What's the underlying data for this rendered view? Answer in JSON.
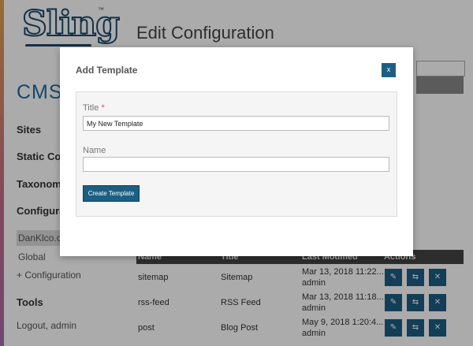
{
  "brand": {
    "logo_text": "Sling",
    "trademark": "™"
  },
  "header": {
    "title": "Edit Configuration"
  },
  "sidebar": {
    "cms_heading": "CMS",
    "sections": [
      "Sites",
      "Static Con",
      "Taxonom",
      "Configura"
    ],
    "config_items": [
      "DanKlco.co",
      "Global"
    ],
    "add_link": "+ Configuration",
    "tools_heading": "Tools",
    "logout": "Logout, admin"
  },
  "table": {
    "headers": [
      "Name",
      "Title",
      "Last Modified",
      "Actions"
    ],
    "rows": [
      {
        "name": "sitemap",
        "title": "Sitemap",
        "date": "Mar 13, 2018 11:22...",
        "user": "admin"
      },
      {
        "name": "rss-feed",
        "title": "RSS Feed",
        "date": "Mar 13, 2018 11:18...",
        "user": "admin"
      },
      {
        "name": "post",
        "title": "Blog Post",
        "date": "May 9, 2018 1:20:4...",
        "user": "admin"
      }
    ],
    "action_icons": {
      "edit": "pencil-icon",
      "move": "arrows-icon",
      "delete": "close-icon"
    }
  },
  "modal": {
    "title": "Add Template",
    "close_label": "x",
    "title_label": "Title",
    "required_mark": "*",
    "title_value": "My New Template",
    "name_label": "Name",
    "name_value": "",
    "submit_label": "Create Template"
  },
  "colors": {
    "primary": "#1c5f82",
    "brand": "#1c4a6e",
    "required": "#d9534f"
  }
}
